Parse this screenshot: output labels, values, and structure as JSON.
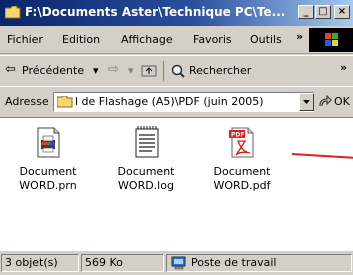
{
  "window": {
    "title": "F:\\Documents Aster\\Technique PC\\Te...",
    "minimize": "_",
    "maximize": "□",
    "close": "×"
  },
  "menu": [
    "Fichier",
    "Edition",
    "Affichage",
    "Favoris",
    "Outils"
  ],
  "menu_more": "»",
  "toolbar": {
    "back_label": "Précédente",
    "back_arrow": "⇦",
    "dropdown": "▾",
    "forward_arrow": "⇨",
    "search_label": "Rechercher",
    "more": "»"
  },
  "address": {
    "label": "Adresse",
    "value": "l de Flashage (A5)\\PDF (juin 2005)",
    "go": "OK"
  },
  "files": [
    {
      "name_line1": "Document",
      "name_line2": "WORD.prn",
      "icon": "prn-file-icon"
    },
    {
      "name_line1": "Document",
      "name_line2": "WORD.log",
      "icon": "log-file-icon"
    },
    {
      "name_line1": "Document",
      "name_line2": "WORD.pdf",
      "icon": "pdf-file-icon"
    }
  ],
  "status": {
    "objects": "3 objet(s)",
    "size": "569 Ko",
    "location": "Poste de travail"
  },
  "colors": {
    "title_start": "#0a246a",
    "title_end": "#a6caf0",
    "face": "#d4d0c8",
    "annotation_line": "#e02020"
  }
}
